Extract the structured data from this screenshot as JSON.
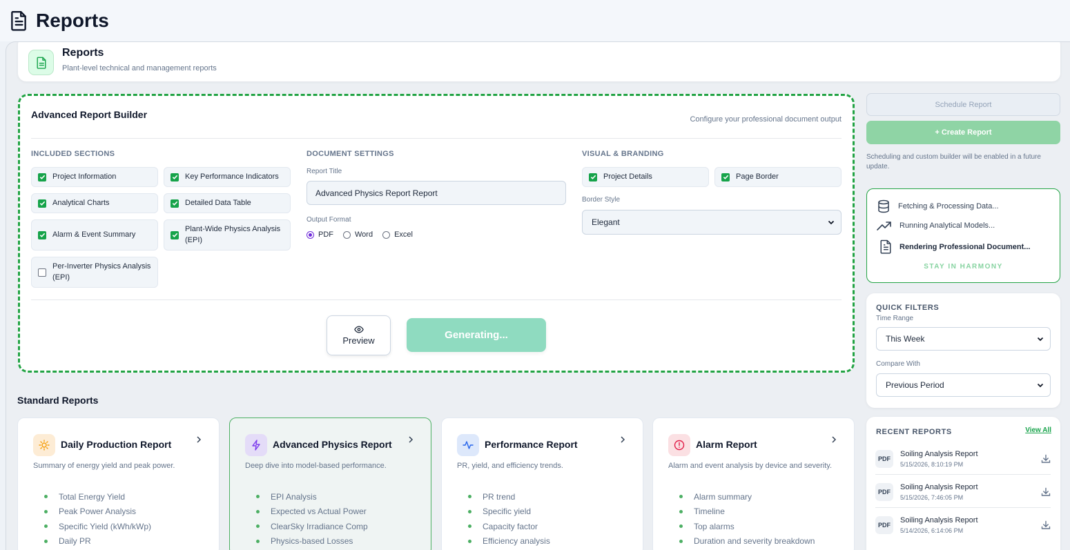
{
  "page": {
    "title": "Reports"
  },
  "header": {
    "title": "Reports",
    "subtitle": "Plant-level technical and management reports"
  },
  "builder": {
    "title": "Advanced Report Builder",
    "subtitle": "Configure your professional document output",
    "sections_heading": "INCLUDED SECTIONS",
    "sections": [
      {
        "label": "Project Information",
        "checked": true
      },
      {
        "label": "Key Performance Indicators",
        "checked": true
      },
      {
        "label": "Analytical Charts",
        "checked": true
      },
      {
        "label": "Detailed Data Table",
        "checked": true
      },
      {
        "label": "Alarm & Event Summary",
        "checked": true
      },
      {
        "label": "Plant-Wide Physics Analysis (EPI)",
        "checked": true
      },
      {
        "label": "Per-Inverter Physics Analysis (EPI)",
        "checked": false
      }
    ],
    "doc_heading": "DOCUMENT SETTINGS",
    "report_title_label": "Report Title",
    "report_title_value": "Advanced Physics Report Report",
    "output_format_label": "Output Format",
    "formats": [
      {
        "label": "PDF",
        "selected": true
      },
      {
        "label": "Word",
        "selected": false
      },
      {
        "label": "Excel",
        "selected": false
      }
    ],
    "visual_heading": "VISUAL & BRANDING",
    "visual_options": [
      {
        "label": "Project Details",
        "checked": true
      },
      {
        "label": "Page Border",
        "checked": true
      }
    ],
    "border_style_label": "Border Style",
    "border_style_value": "Elegant",
    "preview_label": "Preview",
    "generate_label": "Generating..."
  },
  "sidebar": {
    "schedule_label": "Schedule Report",
    "create_label": "+ Create Report",
    "note": "Scheduling and custom builder will be enabled in a future update.",
    "status": {
      "steps": [
        "Fetching & Processing Data...",
        "Running Analytical Models...",
        "Rendering Professional Document..."
      ],
      "footer": "STAY IN HARMONY"
    },
    "filters": {
      "heading": "QUICK FILTERS",
      "time_range_label": "Time Range",
      "time_range_value": "This Week",
      "compare_label": "Compare With",
      "compare_value": "Previous Period"
    },
    "recent": {
      "heading": "RECENT REPORTS",
      "view_all": "View All",
      "items": [
        {
          "badge": "PDF",
          "title": "Soiling Analysis Report",
          "date": "5/15/2026, 8:10:19 PM"
        },
        {
          "badge": "PDF",
          "title": "Soiling Analysis Report",
          "date": "5/15/2026, 7:46:05 PM"
        },
        {
          "badge": "PDF",
          "title": "Soiling Analysis Report",
          "date": "5/14/2026, 6:14:06 PM"
        }
      ]
    }
  },
  "standard": {
    "heading": "Standard Reports",
    "cards": [
      {
        "title": "Daily Production Report",
        "desc": "Summary of energy yield and peak power.",
        "items": [
          "Total Energy Yield",
          "Peak Power Analysis",
          "Specific Yield (kWh/kWp)",
          "Daily PR"
        ],
        "icon": "sun-icon",
        "color": "#f59e0b",
        "bg": "#fdecd5"
      },
      {
        "title": "Advanced Physics Report",
        "desc": "Deep dive into model-based performance.",
        "items": [
          "EPI Analysis",
          "Expected vs Actual Power",
          "ClearSky Irradiance Comp",
          "Physics-based Losses"
        ],
        "icon": "lightning-icon",
        "color": "#7c3aed",
        "bg": "#e4dcf8"
      },
      {
        "title": "Performance Report",
        "desc": "PR, yield, and efficiency trends.",
        "items": [
          "PR trend",
          "Specific yield",
          "Capacity factor",
          "Efficiency analysis"
        ],
        "icon": "activity-icon",
        "color": "#2563eb",
        "bg": "#dde8fb"
      },
      {
        "title": "Alarm Report",
        "desc": "Alarm and event analysis by device and severity.",
        "items": [
          "Alarm summary",
          "Timeline",
          "Top alarms",
          "Duration and severity breakdown"
        ],
        "icon": "alert-icon",
        "color": "#e11d48",
        "bg": "#fbe0e3"
      }
    ]
  }
}
